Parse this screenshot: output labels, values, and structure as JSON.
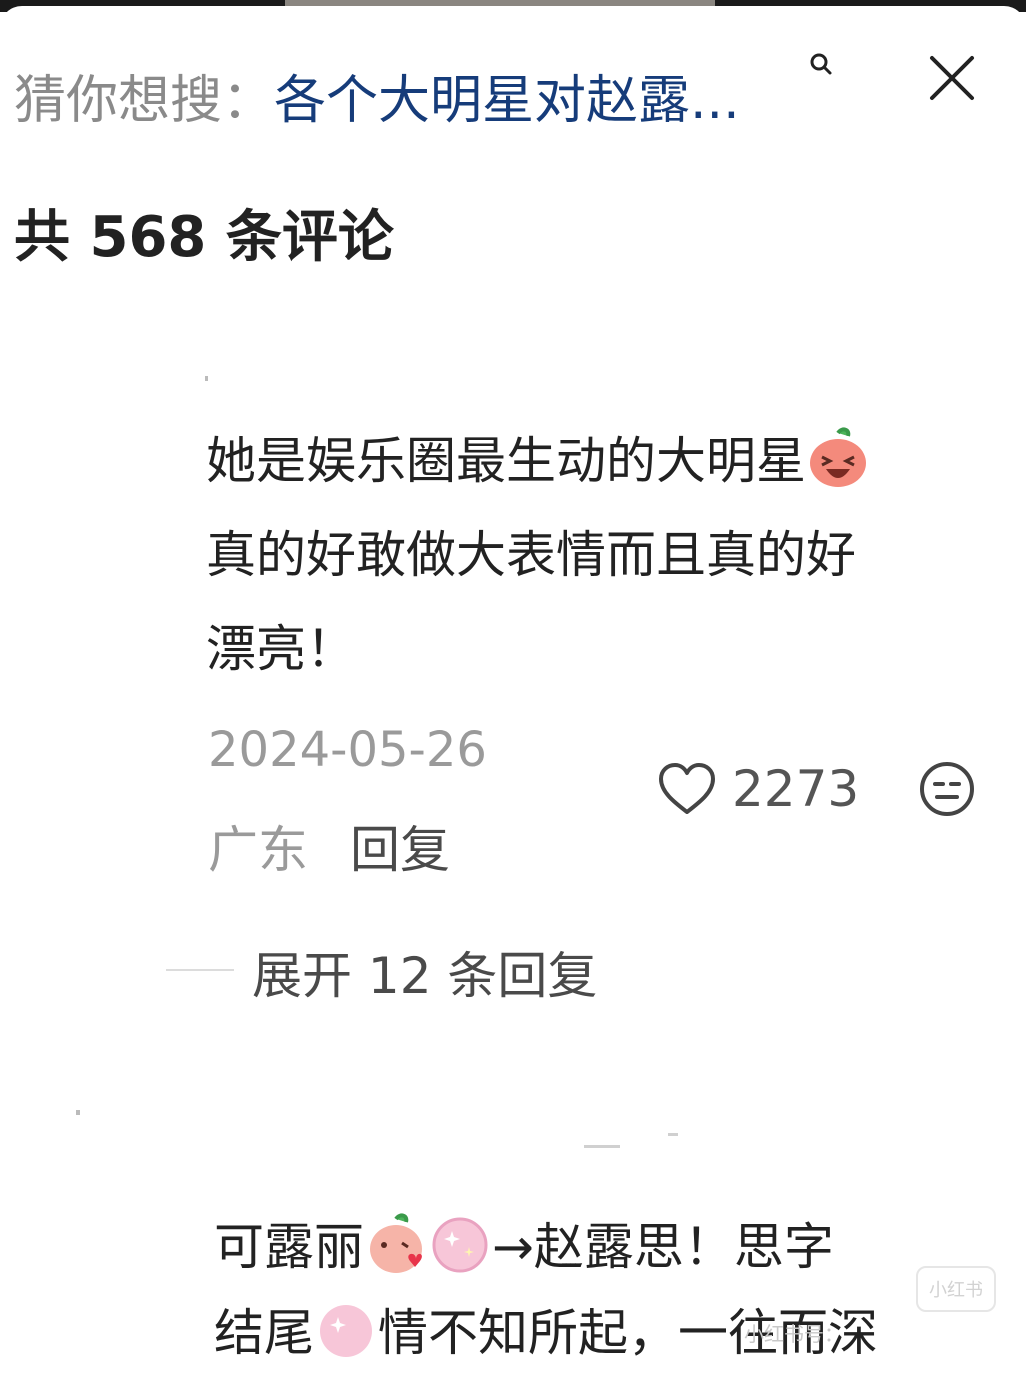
{
  "header": {
    "suggest_prefix": "猜你想搜：",
    "suggest_query": "各个大明星对赵露...",
    "comment_count": "共 568 条评论"
  },
  "comments": [
    {
      "lines": [
        "她是娱乐圈最生动的大明星",
        "真的好敢做大表情而且真的好",
        "漂亮！"
      ],
      "date": "2024-05-26",
      "location": "广东",
      "reply_label": "回复",
      "likes": "2273",
      "expand_label": "展开 12 条回复"
    },
    {
      "line1_a": "可露丽",
      "line1_b": "→赵露思！思字",
      "line2_a": "结尾",
      "line2_b": "情不知所起，一往而深"
    }
  ],
  "watermark": {
    "text": "小红书号：",
    "badge": "小红书"
  },
  "colors": {
    "query": "#163c7a",
    "muted": "#9a9a9a",
    "text": "#222222"
  }
}
